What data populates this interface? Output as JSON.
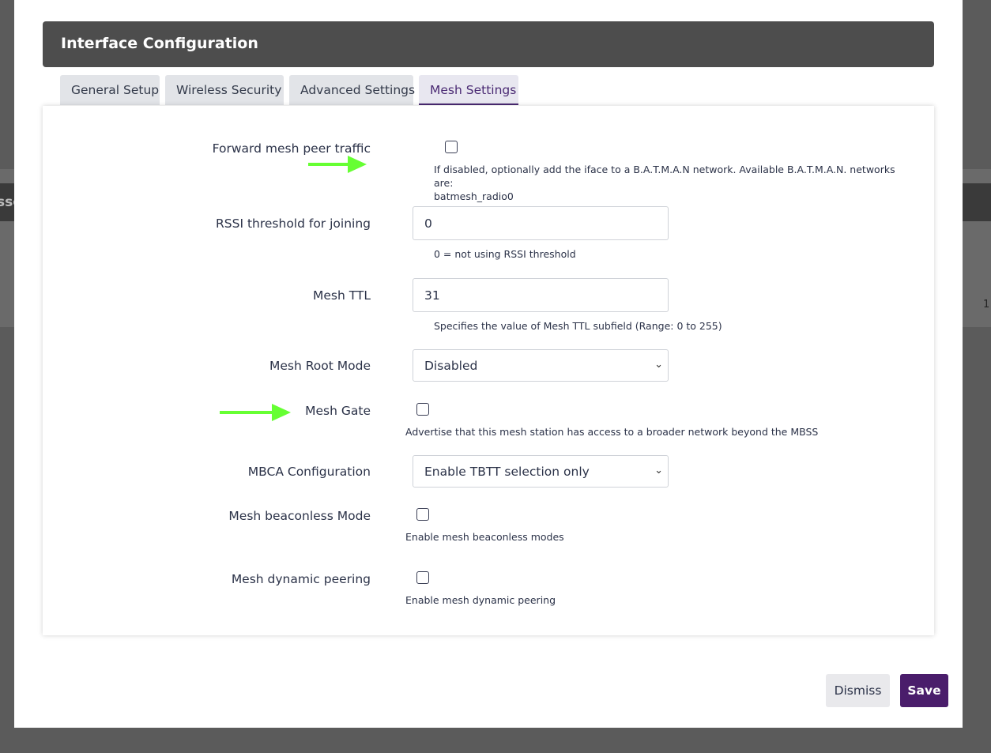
{
  "background": {
    "left_fragment": "sso",
    "right_fragment": "1"
  },
  "modal": {
    "title": "Interface Configuration",
    "tabs": [
      {
        "label": "General Setup",
        "active": false
      },
      {
        "label": "Wireless Security",
        "active": false
      },
      {
        "label": "Advanced Settings",
        "active": false
      },
      {
        "label": "Mesh Settings",
        "active": true
      }
    ],
    "fields": {
      "forward_mesh": {
        "label": "Forward mesh peer traffic",
        "checked": false,
        "help_line1": "If disabled, optionally add the iface to a B.A.T.M.A.N network. Available B.A.T.M.A.N. networks are:",
        "help_line2": "batmesh_radio0"
      },
      "rssi": {
        "label": "RSSI threshold for joining",
        "value": "0",
        "help": "0 = not using RSSI threshold"
      },
      "mesh_ttl": {
        "label": "Mesh TTL",
        "value": "31",
        "help": "Specifies the value of Mesh TTL subfield (Range: 0 to 255)"
      },
      "root_mode": {
        "label": "Mesh Root Mode",
        "value": "Disabled"
      },
      "mesh_gate": {
        "label": "Mesh Gate",
        "checked": false,
        "help": "Advertise that this mesh station has access to a broader network beyond the MBSS"
      },
      "mbca": {
        "label": "MBCA Configuration",
        "value": "Enable TBTT selection only"
      },
      "beaconless": {
        "label": "Mesh beaconless Mode",
        "checked": false,
        "help": "Enable mesh beaconless modes"
      },
      "dynamic_peering": {
        "label": "Mesh dynamic peering",
        "checked": false,
        "help": "Enable mesh dynamic peering"
      }
    },
    "buttons": {
      "dismiss": "Dismiss",
      "save": "Save"
    }
  },
  "colors": {
    "accent": "#4a1d6b",
    "header_bg": "#4d4d4d",
    "annotation_arrow": "#66ff33"
  }
}
